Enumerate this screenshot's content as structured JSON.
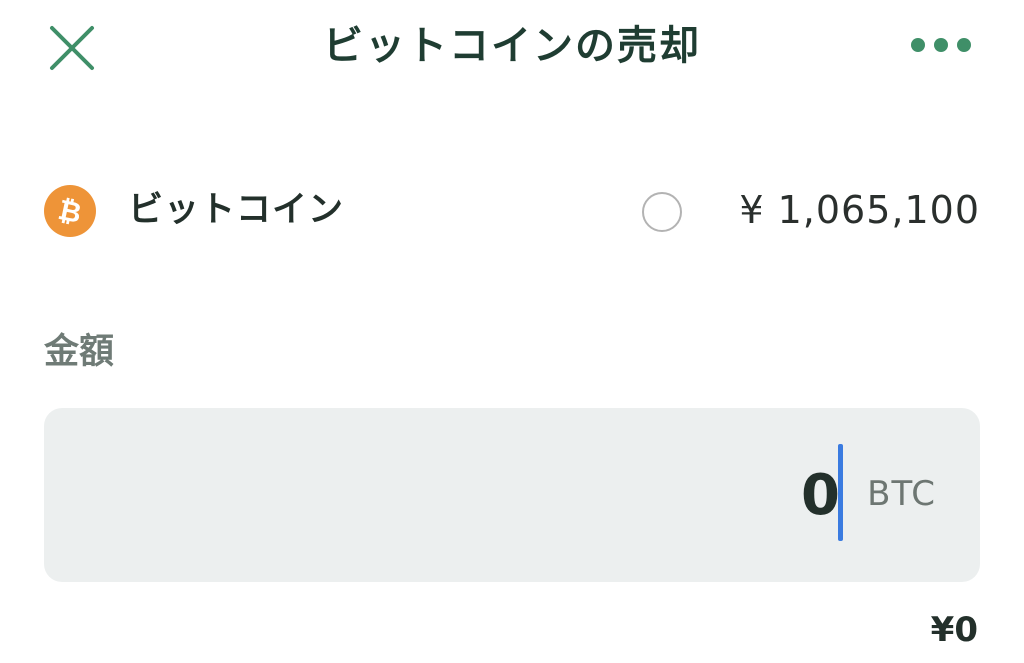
{
  "header": {
    "title": "ビットコインの売却",
    "close_icon": "close-icon",
    "more_icon": "more-horizontal-icon",
    "accent_color": "#3f8f68"
  },
  "asset": {
    "name": "ビットコイン",
    "price": "¥ 1,065,100",
    "logo_icon": "bitcoin-icon",
    "logo_color": "#ee9438",
    "selected": false
  },
  "amount": {
    "label": "金額",
    "value": "0",
    "unit": "BTC",
    "jpy_equivalent": "¥0",
    "caret_color": "#3a7be0"
  }
}
